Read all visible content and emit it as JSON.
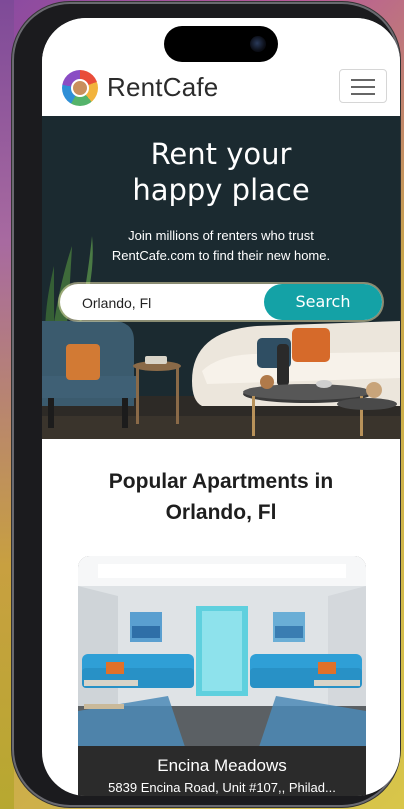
{
  "header": {
    "logo_text": "RentCafe",
    "menu_icon": "hamburger-menu-icon"
  },
  "hero": {
    "title_line1": "Rent your",
    "title_line2": "happy place",
    "subtitle_line1": "Join millions of renters who trust",
    "subtitle_line2": "RentCafe.com to find their new home.",
    "search_value": "Orlando, Fl",
    "search_button": "Search"
  },
  "popular": {
    "title_line1": "Popular Apartments in",
    "title_line2": "Orlando, Fl",
    "listings": [
      {
        "name": "Encina Meadows",
        "address": "5839 Encina Road, Unit #107,, Philad..."
      }
    ]
  },
  "colors": {
    "brand_teal": "#14a2a6",
    "hero_bg": "#1c2a30"
  }
}
